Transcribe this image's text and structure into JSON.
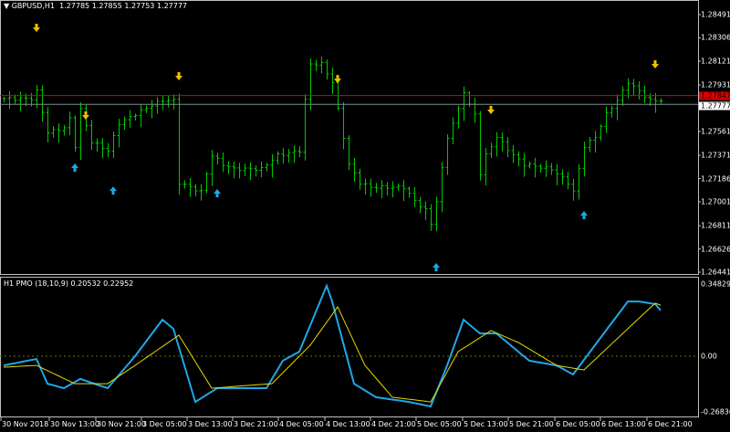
{
  "header": {
    "symbol": "GBPUSD,H1",
    "ohlc": "1.27785 1.27855 1.27753 1.27777"
  },
  "indicator": {
    "label": "H1 PMO (18,10,9) 0.20532 0.22952"
  },
  "colors": {
    "bars": "#00c800",
    "ask_line": "#e00000",
    "bid_line": "#7f8c8d",
    "pmo": "#1ea8e8",
    "signal": "#e6d800",
    "down_arrow": "#f0c000",
    "up_arrow": "#1ea8e8"
  },
  "chart_data": [
    {
      "type": "ohlc",
      "title": "GBPUSD,H1",
      "ylim": [
        1.26441,
        1.28491
      ],
      "yticks": [
        "1.28491",
        "1.28306",
        "1.28121",
        "1.27931",
        "1.27561",
        "1.27371",
        "1.27186",
        "1.27001",
        "1.26811",
        "1.26626",
        "1.26441"
      ],
      "ask": "1.27847",
      "bid": "1.27777",
      "close_anchors": [
        [
          0,
          1.27822
        ],
        [
          5,
          1.27822
        ],
        [
          6,
          1.2788
        ],
        [
          8,
          1.27553
        ],
        [
          11,
          1.27589
        ],
        [
          12,
          1.27662
        ],
        [
          13,
          1.27444
        ],
        [
          14,
          1.27735
        ],
        [
          16,
          1.2748
        ],
        [
          19,
          1.27408
        ],
        [
          21,
          1.27626
        ],
        [
          24,
          1.27699
        ],
        [
          27,
          1.27771
        ],
        [
          29,
          1.27808
        ],
        [
          31,
          1.27808
        ],
        [
          32,
          1.27153
        ],
        [
          34,
          1.27117
        ],
        [
          36,
          1.27081
        ],
        [
          38,
          1.27371
        ],
        [
          40,
          1.27299
        ],
        [
          42,
          1.27262
        ],
        [
          47,
          1.27262
        ],
        [
          50,
          1.27371
        ],
        [
          54,
          1.27408
        ],
        [
          55,
          1.27808
        ],
        [
          56,
          1.28098
        ],
        [
          58,
          1.28098
        ],
        [
          60,
          1.27953
        ],
        [
          61,
          1.27735
        ],
        [
          63,
          1.27299
        ],
        [
          65,
          1.27153
        ],
        [
          67,
          1.27117
        ],
        [
          73,
          1.27117
        ],
        [
          75,
          1.27008
        ],
        [
          77,
          1.26935
        ],
        [
          78,
          1.26826
        ],
        [
          79,
          1.27008
        ],
        [
          81,
          1.27517
        ],
        [
          83,
          1.27735
        ],
        [
          84,
          1.2788
        ],
        [
          85,
          1.27771
        ],
        [
          86,
          1.27699
        ],
        [
          87,
          1.27226
        ],
        [
          88,
          1.27371
        ],
        [
          90,
          1.27517
        ],
        [
          93,
          1.27371
        ],
        [
          95,
          1.27299
        ],
        [
          100,
          1.27262
        ],
        [
          103,
          1.27153
        ],
        [
          104,
          1.27081
        ],
        [
          106,
          1.27444
        ],
        [
          108,
          1.27517
        ],
        [
          110,
          1.27699
        ],
        [
          112,
          1.27808
        ],
        [
          114,
          1.27953
        ],
        [
          116,
          1.2788
        ],
        [
          118,
          1.27808
        ],
        [
          120,
          1.27808
        ]
      ],
      "down_arrows": [
        [
          6,
          1.28375
        ],
        [
          15,
          1.27677
        ],
        [
          32,
          1.27989
        ],
        [
          61,
          1.27967
        ],
        [
          89,
          1.2772
        ],
        [
          119,
          1.28084
        ]
      ],
      "up_arrows": [
        [
          13,
          1.27284
        ],
        [
          20,
          1.27102
        ],
        [
          39,
          1.27081
        ],
        [
          79,
          1.26492
        ],
        [
          106,
          1.26906
        ]
      ]
    },
    {
      "type": "line",
      "title": "H1 PMO (18,10,9)",
      "ylim": [
        -0.26836,
        0.34829
      ],
      "yticks": [
        "0.34829",
        "0.00",
        "-0.26836"
      ],
      "series": [
        {
          "name": "PMO",
          "points": [
            [
              0,
              -0.043
            ],
            [
              6,
              -0.013
            ],
            [
              8,
              -0.128
            ],
            [
              11,
              -0.149
            ],
            [
              14,
              -0.106
            ],
            [
              19,
              -0.149
            ],
            [
              24,
              0
            ],
            [
              29,
              0.17
            ],
            [
              31,
              0.128
            ],
            [
              35,
              -0.213
            ],
            [
              39,
              -0.149
            ],
            [
              48,
              -0.149
            ],
            [
              51,
              -0.021
            ],
            [
              54,
              0.021
            ],
            [
              59,
              0.328
            ],
            [
              60,
              0.255
            ],
            [
              64,
              -0.128
            ],
            [
              68,
              -0.191
            ],
            [
              74,
              -0.213
            ],
            [
              78,
              -0.234
            ],
            [
              81,
              -0.043
            ],
            [
              84,
              0.17
            ],
            [
              87,
              0.106
            ],
            [
              90,
              0.106
            ],
            [
              96,
              -0.021
            ],
            [
              101,
              -0.043
            ],
            [
              104,
              -0.085
            ],
            [
              109,
              0.085
            ],
            [
              114,
              0.255
            ],
            [
              116,
              0.255
            ],
            [
              119,
              0.243
            ],
            [
              120,
              0.213
            ]
          ]
        },
        {
          "name": "Signal",
          "points": [
            [
              0,
              -0.051
            ],
            [
              6,
              -0.043
            ],
            [
              13,
              -0.128
            ],
            [
              19,
              -0.128
            ],
            [
              24,
              -0.043
            ],
            [
              32,
              0.098
            ],
            [
              38,
              -0.149
            ],
            [
              49,
              -0.128
            ],
            [
              56,
              0.051
            ],
            [
              61,
              0.23
            ],
            [
              66,
              -0.043
            ],
            [
              71,
              -0.191
            ],
            [
              78,
              -0.213
            ],
            [
              83,
              0.021
            ],
            [
              89,
              0.119
            ],
            [
              94,
              0.064
            ],
            [
              101,
              -0.043
            ],
            [
              106,
              -0.064
            ],
            [
              114,
              0.128
            ],
            [
              119,
              0.247
            ],
            [
              120,
              0.238
            ]
          ]
        }
      ]
    }
  ],
  "time_axis": [
    "30 Nov 2018",
    "30 Nov 13:00",
    "30 Nov 21:00",
    "3 Dec 05:00",
    "3 Dec 13:00",
    "3 Dec 21:00",
    "4 Dec 05:00",
    "4 Dec 13:00",
    "4 Dec 21:00",
    "5 Dec 05:00",
    "5 Dec 13:00",
    "5 Dec 21:00",
    "6 Dec 05:00",
    "6 Dec 13:00",
    "6 Dec 21:00"
  ]
}
